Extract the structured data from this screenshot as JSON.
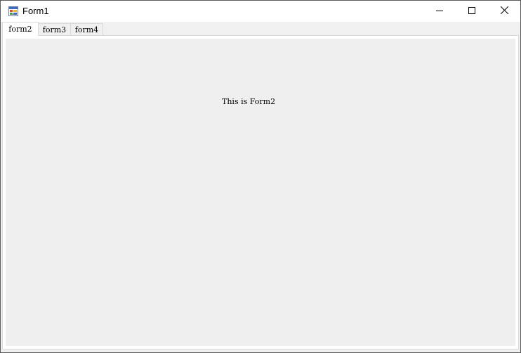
{
  "window": {
    "title": "Form1",
    "icon": "winforms-app-icon"
  },
  "caption_buttons": {
    "minimize": "minimize-icon",
    "maximize": "maximize-icon",
    "close": "close-icon"
  },
  "tabs": [
    {
      "label": "form2",
      "active": true
    },
    {
      "label": "form3",
      "active": false
    },
    {
      "label": "form4",
      "active": false
    }
  ],
  "panel": {
    "label": "This is Form2"
  }
}
